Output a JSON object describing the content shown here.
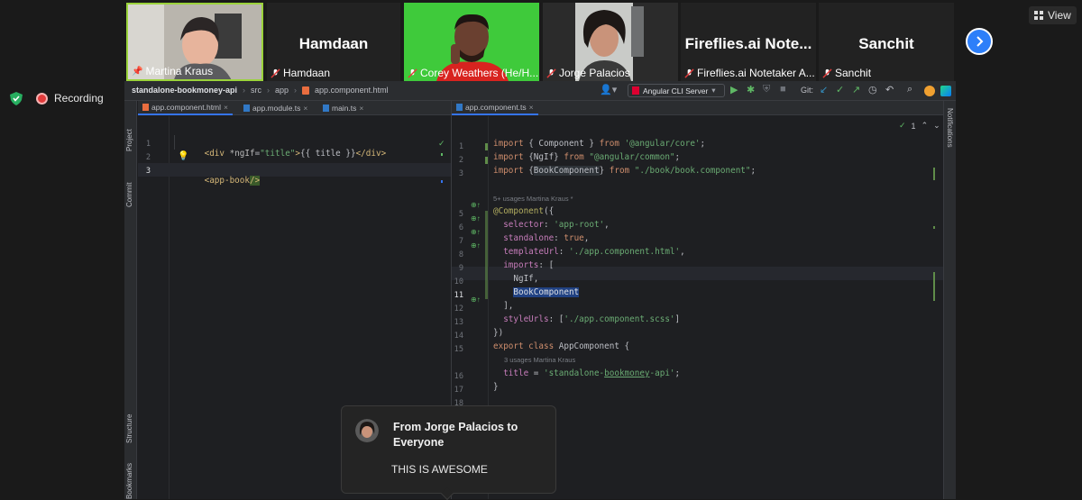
{
  "participants": [
    {
      "name": "Martina Kraus",
      "has_video": true,
      "muted": false,
      "pinned": true,
      "active": true
    },
    {
      "name": "Hamdaan",
      "has_video": false,
      "muted": true
    },
    {
      "name": "Corey Weathers (He/H...",
      "has_video": true,
      "muted": true
    },
    {
      "name": "Jorge Palacios",
      "has_video": true,
      "muted": true
    },
    {
      "name": "Fireflies.ai Notetaker A...",
      "big_label": "Fireflies.ai  Note...",
      "has_video": false,
      "muted": true
    },
    {
      "name": "Sanchit",
      "has_video": false,
      "muted": true
    }
  ],
  "big_labels": {
    "hamdaan": "Hamdaan",
    "fireflies": "Fireflies.ai  Note...",
    "sanchit": "Sanchit"
  },
  "view_button": "View",
  "recording_label": "Recording",
  "ide": {
    "breadcrumb": [
      "standalone-bookmoney-api",
      "src",
      "app",
      "app.component.html"
    ],
    "run_config": "Angular CLI Server",
    "git_label": "Git:",
    "left_tabs": [
      "app.component.html",
      "app.module.ts",
      "main.ts"
    ],
    "right_tab": "app.component.ts",
    "left_sidebar": [
      "Project",
      "Commit",
      "Structure",
      "Bookmarks"
    ],
    "right_sidebar": "Notifications",
    "inspection_count": "1",
    "left_lines": [
      {
        "n": "1",
        "text": "<div *ngIf=\"title\">{{ title }}</div>"
      },
      {
        "n": "2",
        "text": ""
      },
      {
        "n": "3",
        "text": "<app-book/>"
      }
    ],
    "right_lines": [
      {
        "n": "1",
        "text": "import { Component } from '@angular/core';"
      },
      {
        "n": "2",
        "text": "import {NgIf} from \"@angular/common\";"
      },
      {
        "n": "3",
        "text": "import {BookComponent} from \"./book/book.component\";"
      },
      {
        "n": "",
        "hint": "5+ usages   Martina Kraus *"
      },
      {
        "n": "5",
        "text": "@Component({"
      },
      {
        "n": "6",
        "text": "  selector: 'app-root',"
      },
      {
        "n": "7",
        "text": "  standalone: true,"
      },
      {
        "n": "8",
        "text": "  templateUrl: './app.component.html',"
      },
      {
        "n": "9",
        "text": "  imports: ["
      },
      {
        "n": "10",
        "text": "    NgIf,"
      },
      {
        "n": "11",
        "text": "    BookComponent"
      },
      {
        "n": "12",
        "text": "  ],"
      },
      {
        "n": "13",
        "text": "  styleUrls: ['./app.component.scss']"
      },
      {
        "n": "14",
        "text": "})"
      },
      {
        "n": "15",
        "text": "export class AppComponent {"
      },
      {
        "n": "",
        "hint": "3 usages   Martina Kraus"
      },
      {
        "n": "16",
        "text": "  title = 'standalone-bookmoney-api';"
      },
      {
        "n": "17",
        "text": "}"
      },
      {
        "n": "18",
        "text": ""
      }
    ]
  },
  "chat_popup": {
    "title": "From Jorge Palacios to Everyone",
    "title_line1": "From Jorge Palacios to",
    "title_line2": "Everyone",
    "message": "THIS IS AWESOME"
  },
  "colors": {
    "accent": "#3574f0",
    "recording": "#e23b3b",
    "active_border": "#9bd33b",
    "shield": "#27ae60"
  }
}
